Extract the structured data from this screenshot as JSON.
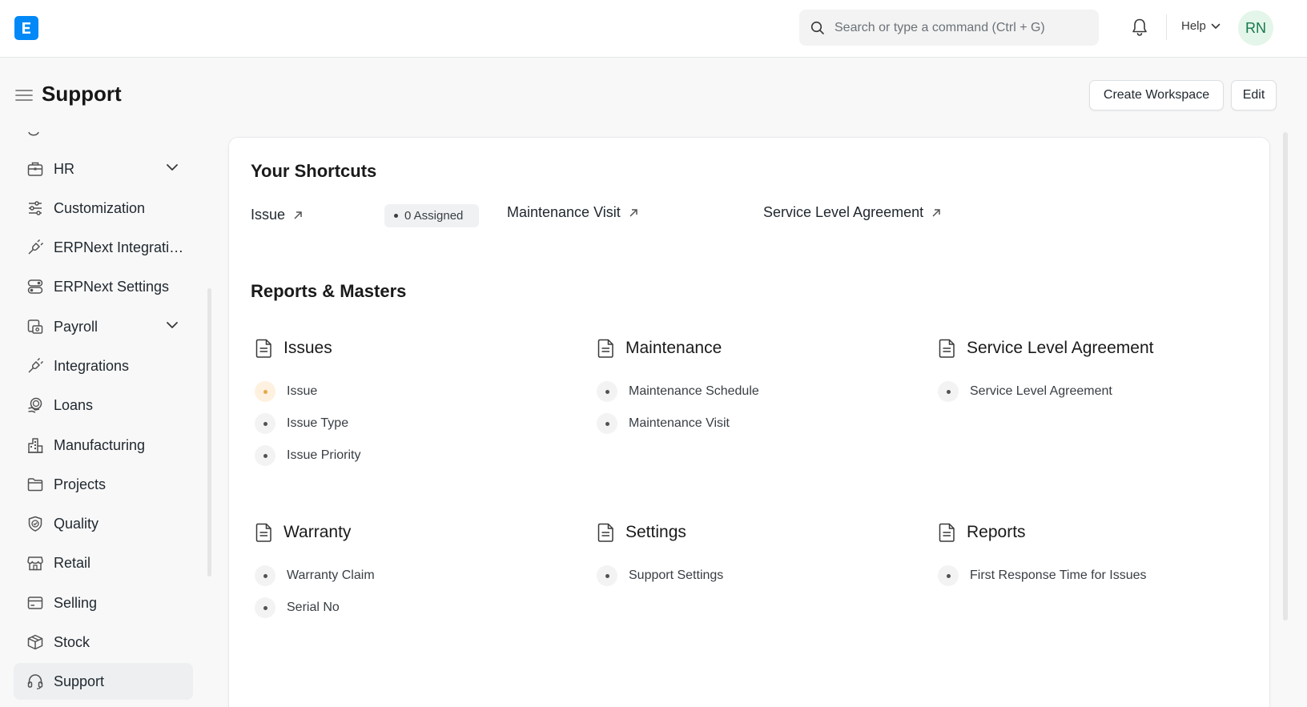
{
  "navbar": {
    "logo_letter": "E",
    "search_placeholder": "Search or type a command (Ctrl + G)",
    "help_label": "Help",
    "avatar_initials": "RN"
  },
  "page": {
    "title": "Support",
    "create_workspace_label": "Create Workspace",
    "edit_label": "Edit"
  },
  "sidebar": {
    "items": [
      {
        "label": "HR",
        "icon": "briefcase-icon",
        "has_chevron": true
      },
      {
        "label": "Customization",
        "icon": "sliders-icon",
        "has_chevron": false
      },
      {
        "label": "ERPNext Integrations",
        "icon": "plug-icon",
        "has_chevron": false
      },
      {
        "label": "ERPNext Settings",
        "icon": "toggle-icon",
        "has_chevron": false
      },
      {
        "label": "Payroll",
        "icon": "cash-icon",
        "has_chevron": true
      },
      {
        "label": "Integrations",
        "icon": "plug-icon",
        "has_chevron": false
      },
      {
        "label": "Loans",
        "icon": "loan-icon",
        "has_chevron": false
      },
      {
        "label": "Manufacturing",
        "icon": "factory-icon",
        "has_chevron": false
      },
      {
        "label": "Projects",
        "icon": "folder-icon",
        "has_chevron": false
      },
      {
        "label": "Quality",
        "icon": "shield-check-icon",
        "has_chevron": false
      },
      {
        "label": "Retail",
        "icon": "store-icon",
        "has_chevron": false
      },
      {
        "label": "Selling",
        "icon": "card-icon",
        "has_chevron": false
      },
      {
        "label": "Stock",
        "icon": "box-icon",
        "has_chevron": false
      },
      {
        "label": "Support",
        "icon": "headset-icon",
        "has_chevron": false,
        "active": true
      }
    ]
  },
  "shortcuts": {
    "title": "Your Shortcuts",
    "items": [
      {
        "label": "Issue",
        "badge": "0 Assigned"
      },
      {
        "label": "Maintenance Visit"
      },
      {
        "label": "Service Level Agreement"
      }
    ]
  },
  "reports": {
    "title": "Reports & Masters",
    "groups": [
      {
        "title": "Issues",
        "links": [
          "Issue",
          "Issue Type",
          "Issue Priority"
        ]
      },
      {
        "title": "Maintenance",
        "links": [
          "Maintenance Schedule",
          "Maintenance Visit"
        ]
      },
      {
        "title": "Service Level Agreement",
        "links": [
          "Service Level Agreement"
        ]
      },
      {
        "title": "Warranty",
        "links": [
          "Warranty Claim",
          "Serial No"
        ]
      },
      {
        "title": "Settings",
        "links": [
          "Support Settings"
        ]
      },
      {
        "title": "Reports",
        "links": [
          "First Response Time for Issues"
        ]
      }
    ]
  },
  "colors": {
    "brand": "#0289f7",
    "avatar_bg": "#e4f5e9",
    "avatar_text": "#16794c",
    "warning_bullet": "#e7a74a"
  }
}
